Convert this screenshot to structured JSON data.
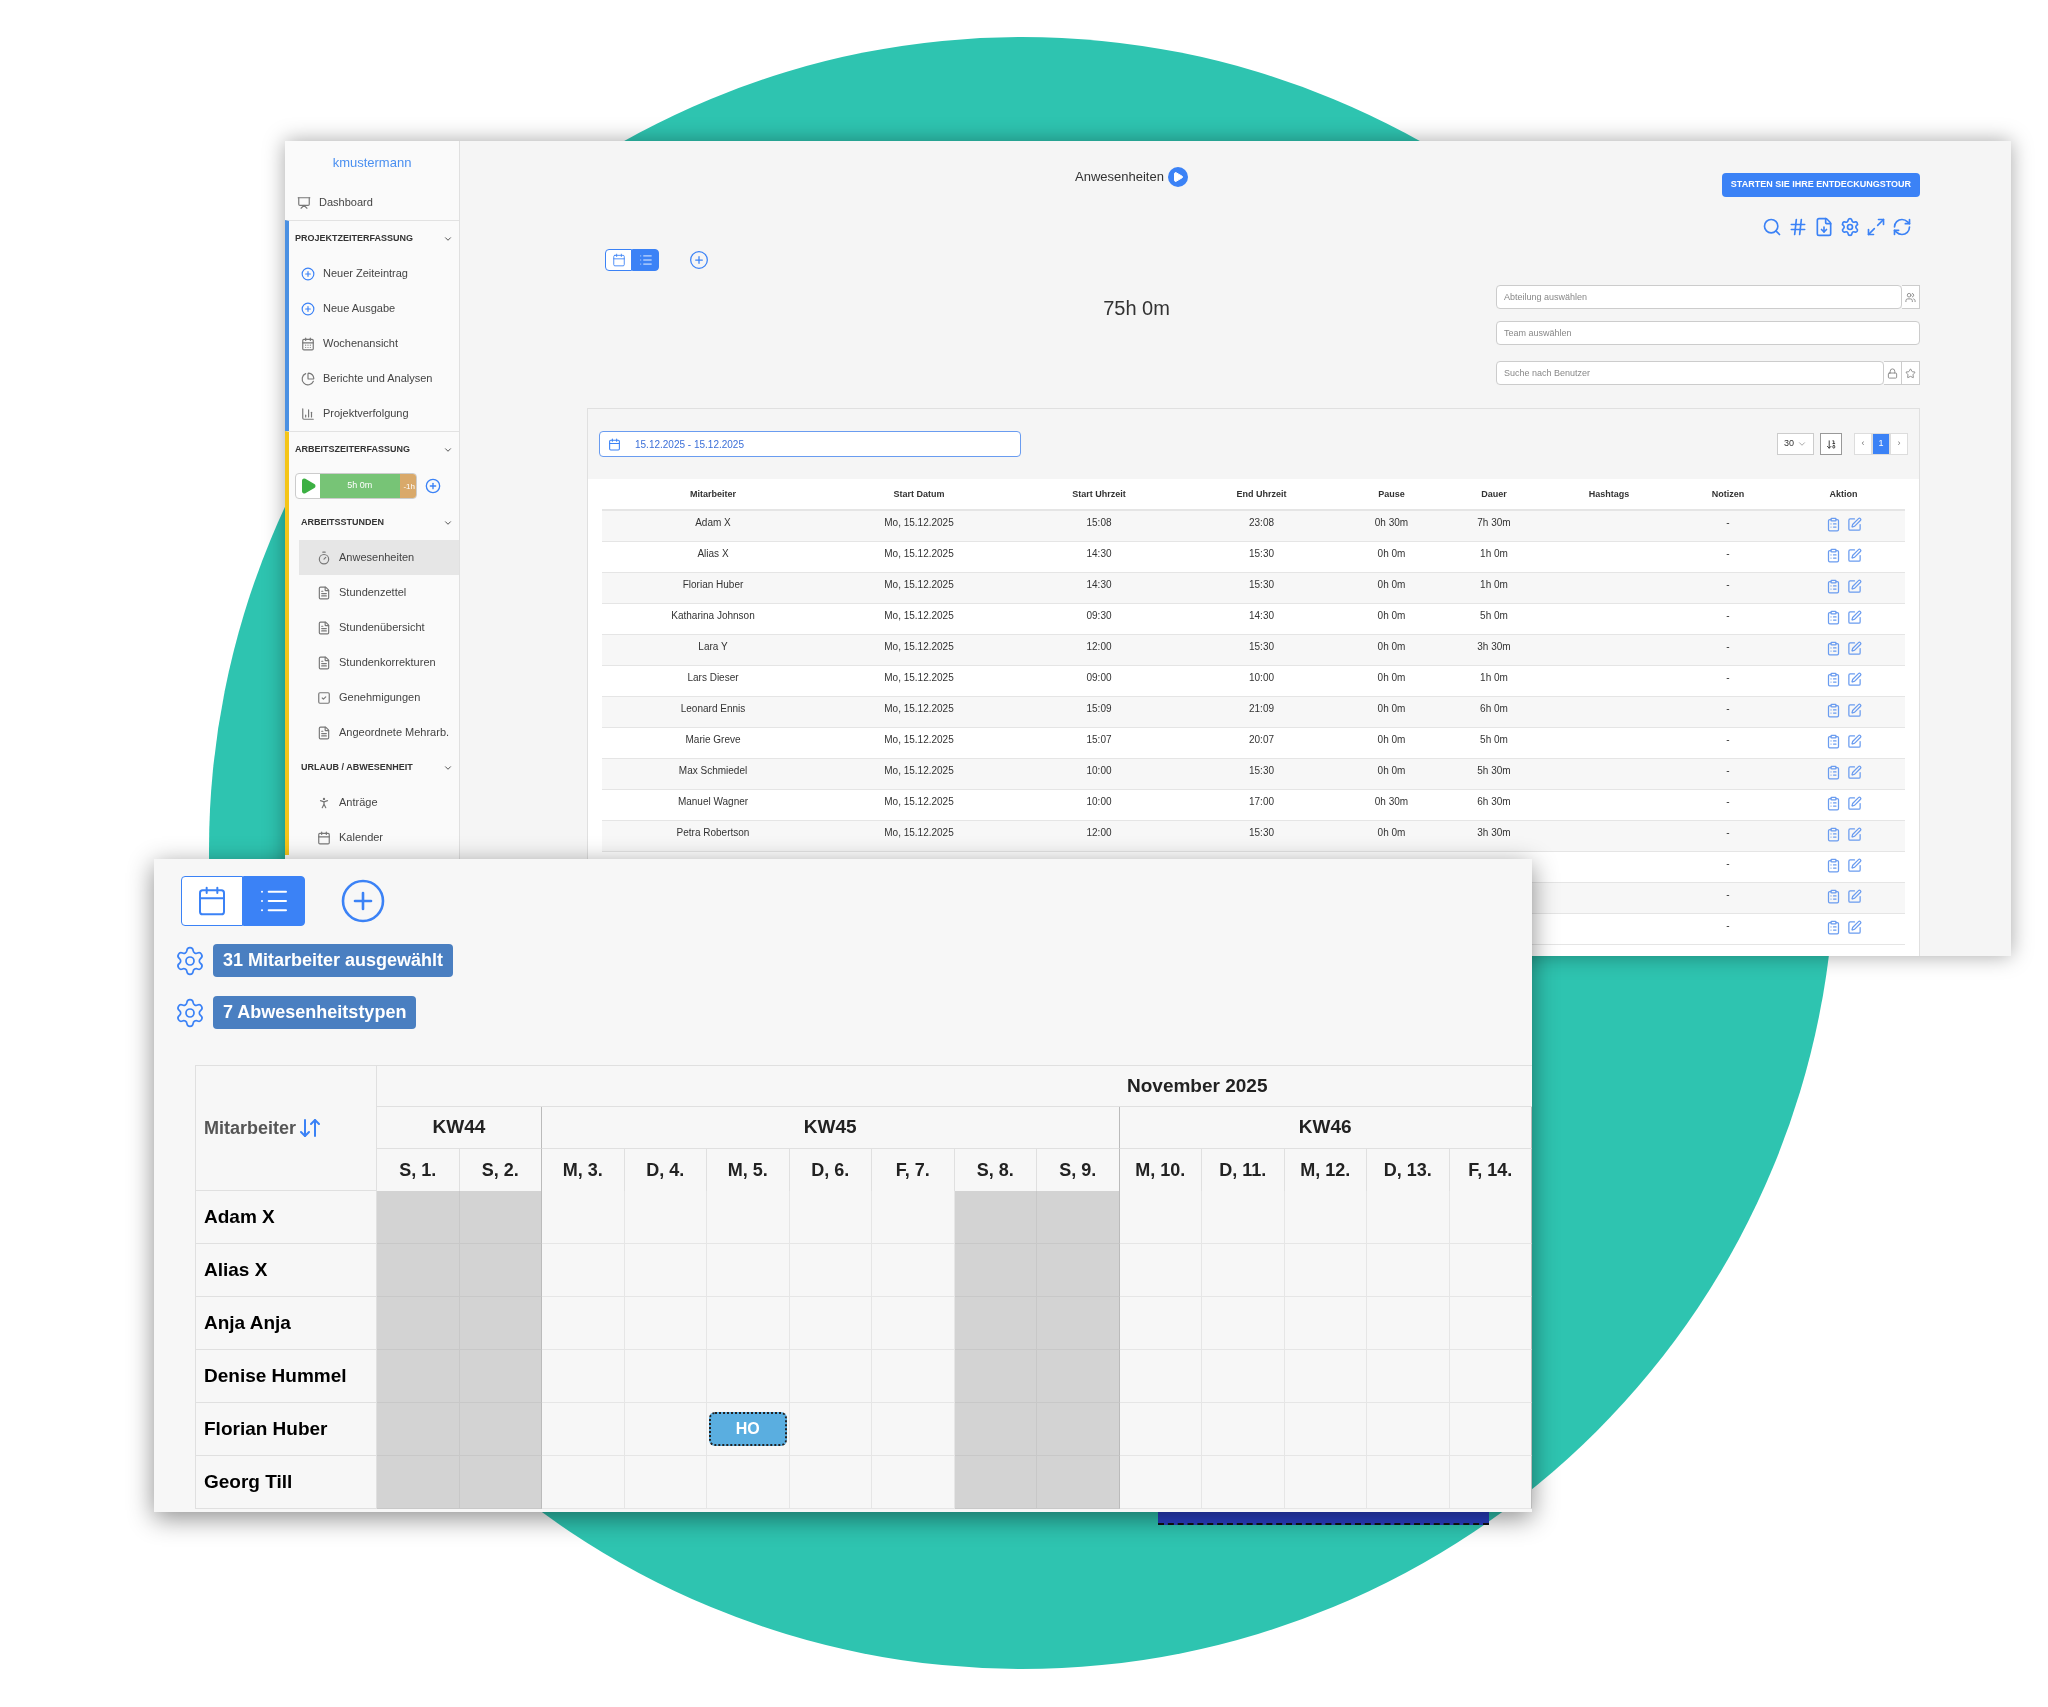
{
  "back_window": {
    "sidebar": {
      "user": "kmustermann",
      "items": [
        {
          "kind": "link",
          "label": "Dashboard",
          "selected": false
        },
        {
          "kind": "section",
          "label": "PROJEKTZEITERFASSUNG",
          "expanded": true,
          "color": "#4a90e2",
          "children": [
            {
              "kind": "link",
              "label": "Neuer Zeiteintrag",
              "selected": false
            },
            {
              "kind": "link",
              "label": "Neue Ausgabe",
              "selected": false
            },
            {
              "kind": "link",
              "label": "Wochenansicht",
              "selected": false
            },
            {
              "kind": "link",
              "label": "Berichte und Analysen",
              "selected": false
            },
            {
              "kind": "link",
              "label": "Projektverfolgung",
              "selected": false
            }
          ]
        },
        {
          "kind": "section",
          "label": "ARBEITSZEITERFASSUNG",
          "expanded": true,
          "color": "#f5c518",
          "children": [
            {
              "kind": "timer",
              "worked": "5h 0m",
              "remaining": "-1h",
              "level": 0.83
            },
            {
              "kind": "section",
              "label": "ARBEITSSTUNDEN",
              "expanded": true,
              "children": [
                {
                  "kind": "link",
                  "label": "Anwesenheiten",
                  "selected": true
                },
                {
                  "kind": "link",
                  "label": "Stundenzettel",
                  "selected": false
                },
                {
                  "kind": "link",
                  "label": "Stundenübersicht",
                  "selected": false
                },
                {
                  "kind": "link",
                  "label": "Stundenkorrekturen",
                  "selected": false
                },
                {
                  "kind": "link",
                  "label": "Genehmigungen",
                  "selected": false
                },
                {
                  "kind": "link",
                  "label": "Angeordnete Mehrarb.",
                  "selected": false
                }
              ]
            },
            {
              "kind": "section",
              "label": "URLAUB / ABWESENHEIT",
              "expanded": true,
              "children": [
                {
                  "kind": "link",
                  "label": "Anträge",
                  "selected": false
                },
                {
                  "kind": "link",
                  "label": "Kalender",
                  "selected": false
                }
              ]
            }
          ]
        }
      ]
    },
    "title": "Anwesenheiten",
    "tour_button": "STARTEN SIE IHRE ENTDECKUNGSTOUR",
    "view_toggle": [
      {
        "selected": false
      },
      {
        "selected": true
      }
    ],
    "total": "75h 0m",
    "filters": [
      {
        "placeholder": "Abteilung auswählen"
      },
      {
        "placeholder": "Team auswählen"
      },
      {
        "placeholder": "Suche nach Benutzer"
      }
    ],
    "date_range": "15.12.2025 - 15.12.2025",
    "page_size": "30",
    "pagination": [
      {
        "label": "‹",
        "selected": false
      },
      {
        "label": "1",
        "selected": true
      },
      {
        "label": "›",
        "selected": false
      }
    ],
    "table": {
      "columns": [
        "Mitarbeiter",
        "Start Datum",
        "Start Uhrzeit",
        "End Uhrzeit",
        "Pause",
        "Dauer",
        "Hashtags",
        "Notizen",
        "Aktion"
      ],
      "rows": [
        {
          "name": "Adam X",
          "date": "Mo, 15.12.2025",
          "start": "15:08",
          "end": "23:08",
          "pause": "0h 30m",
          "duration": "7h 30m",
          "notes": "-"
        },
        {
          "name": "Alias X",
          "date": "Mo, 15.12.2025",
          "start": "14:30",
          "end": "15:30",
          "pause": "0h 0m",
          "duration": "1h 0m",
          "notes": "-"
        },
        {
          "name": "Florian Huber",
          "date": "Mo, 15.12.2025",
          "start": "14:30",
          "end": "15:30",
          "pause": "0h 0m",
          "duration": "1h 0m",
          "notes": "-"
        },
        {
          "name": "Katharina Johnson",
          "date": "Mo, 15.12.2025",
          "start": "09:30",
          "end": "14:30",
          "pause": "0h 0m",
          "duration": "5h 0m",
          "notes": "-"
        },
        {
          "name": "Lara Y",
          "date": "Mo, 15.12.2025",
          "start": "12:00",
          "end": "15:30",
          "pause": "0h 0m",
          "duration": "3h 30m",
          "notes": "-"
        },
        {
          "name": "Lars Dieser",
          "date": "Mo, 15.12.2025",
          "start": "09:00",
          "end": "10:00",
          "pause": "0h 0m",
          "duration": "1h 0m",
          "notes": "-"
        },
        {
          "name": "Leonard Ennis",
          "date": "Mo, 15.12.2025",
          "start": "15:09",
          "end": "21:09",
          "pause": "0h 0m",
          "duration": "6h 0m",
          "notes": "-"
        },
        {
          "name": "Marie Greve",
          "date": "Mo, 15.12.2025",
          "start": "15:07",
          "end": "20:07",
          "pause": "0h 0m",
          "duration": "5h 0m",
          "notes": "-"
        },
        {
          "name": "Max Schmiedel",
          "date": "Mo, 15.12.2025",
          "start": "10:00",
          "end": "15:30",
          "pause": "0h 0m",
          "duration": "5h 30m",
          "notes": "-"
        },
        {
          "name": "Manuel Wagner",
          "date": "Mo, 15.12.2025",
          "start": "10:00",
          "end": "17:00",
          "pause": "0h 30m",
          "duration": "6h 30m",
          "notes": "-"
        },
        {
          "name": "Petra Robertson",
          "date": "Mo, 15.12.2025",
          "start": "12:00",
          "end": "15:30",
          "pause": "0h 0m",
          "duration": "3h 30m",
          "notes": "-"
        },
        {
          "notes": "-"
        },
        {
          "notes": "-"
        },
        {
          "notes": "-"
        }
      ]
    }
  },
  "front_window": {
    "view_toggle": [
      {
        "selected": false
      },
      {
        "selected": true
      }
    ],
    "selections": [
      "31 Mitarbeiter ausgewählt",
      "7 Abwesenheitstypen"
    ],
    "calendar": {
      "name_header": "Mitarbeiter",
      "month": "November 2025",
      "weeks": [
        {
          "label": "KW44",
          "days": [
            {
              "label": "S, 1.",
              "weekend": true
            },
            {
              "label": "S, 2.",
              "weekend": true
            }
          ]
        },
        {
          "label": "KW45",
          "days": [
            {
              "label": "M, 3.",
              "weekend": false
            },
            {
              "label": "D, 4.",
              "weekend": false
            },
            {
              "label": "M, 5.",
              "weekend": false
            },
            {
              "label": "D, 6.",
              "weekend": false
            },
            {
              "label": "F, 7.",
              "weekend": false
            },
            {
              "label": "S, 8.",
              "weekend": true
            },
            {
              "label": "S, 9.",
              "weekend": true
            }
          ]
        },
        {
          "label": "KW46",
          "days": [
            {
              "label": "M, 10.",
              "weekend": false
            },
            {
              "label": "D, 11.",
              "weekend": false
            },
            {
              "label": "M, 12.",
              "weekend": false
            },
            {
              "label": "D, 13.",
              "weekend": false
            },
            {
              "label": "F, 14.",
              "weekend": false
            }
          ]
        }
      ],
      "rows": [
        {
          "name": "Adam X",
          "cells": [
            {
              "kind": "free"
            },
            {
              "kind": "free"
            },
            {
              "kind": "free"
            },
            {
              "kind": "free"
            },
            {
              "kind": "free"
            },
            {
              "kind": "free"
            },
            {
              "kind": "free"
            },
            {
              "kind": "free"
            },
            {
              "kind": "free"
            },
            {
              "kind": "free"
            },
            {
              "kind": "free"
            },
            {
              "kind": "free"
            },
            {
              "kind": "free"
            },
            {
              "kind": "free"
            }
          ]
        },
        {
          "name": "Alias X",
          "cells": [
            {
              "kind": "free"
            },
            {
              "kind": "free"
            },
            {
              "kind": "free"
            },
            {
              "kind": "free"
            },
            {
              "kind": "free"
            },
            {
              "kind": "free"
            },
            {
              "kind": "free"
            },
            {
              "kind": "free"
            },
            {
              "kind": "free"
            },
            {
              "kind": "free"
            },
            {
              "kind": "free"
            },
            {
              "kind": "free"
            },
            {
              "kind": "free"
            },
            {
              "kind": "free"
            }
          ]
        },
        {
          "name": "Anja Anja",
          "cells": [
            {
              "kind": "free"
            },
            {
              "kind": "free"
            },
            {
              "kind": "free"
            },
            {
              "kind": "free"
            },
            {
              "kind": "free"
            },
            {
              "kind": "free"
            },
            {
              "kind": "free"
            },
            {
              "kind": "free"
            },
            {
              "kind": "free"
            },
            {
              "kind": "free"
            },
            {
              "kind": "free"
            },
            {
              "kind": "free"
            },
            {
              "kind": "free"
            },
            {
              "kind": "free"
            }
          ]
        },
        {
          "name": "Denise Hummel",
          "cells": [
            {
              "kind": "free"
            },
            {
              "kind": "free"
            },
            {
              "kind": "free"
            },
            {
              "kind": "free"
            },
            {
              "kind": "free"
            },
            {
              "kind": "free"
            },
            {
              "kind": "free"
            },
            {
              "kind": "free"
            },
            {
              "kind": "free"
            },
            {
              "kind": "free"
            },
            {
              "kind": "free"
            },
            {
              "kind": "free"
            },
            {
              "kind": "free"
            },
            {
              "kind": "free"
            }
          ]
        },
        {
          "name": "Florian Huber",
          "cells": [
            {
              "kind": "free"
            },
            {
              "kind": "free"
            },
            {
              "kind": "free"
            },
            {
              "kind": "free"
            },
            {
              "kind": "absence",
              "label": "HO"
            },
            {
              "kind": "free"
            },
            {
              "kind": "free"
            },
            {
              "kind": "free"
            },
            {
              "kind": "free"
            },
            {
              "kind": "free"
            },
            {
              "kind": "free"
            },
            {
              "kind": "free"
            },
            {
              "kind": "free"
            },
            {
              "kind": "free"
            }
          ]
        },
        {
          "name": "Georg Till",
          "cells": [
            {
              "kind": "free"
            },
            {
              "kind": "free"
            },
            {
              "kind": "free"
            },
            {
              "kind": "free"
            },
            {
              "kind": "free"
            },
            {
              "kind": "free"
            },
            {
              "kind": "free"
            },
            {
              "kind": "free"
            },
            {
              "kind": "free"
            },
            {
              "kind": "free"
            },
            {
              "kind": "free"
            },
            {
              "kind": "free"
            },
            {
              "kind": "free"
            },
            {
              "kind": "free"
            }
          ]
        }
      ]
    }
  }
}
